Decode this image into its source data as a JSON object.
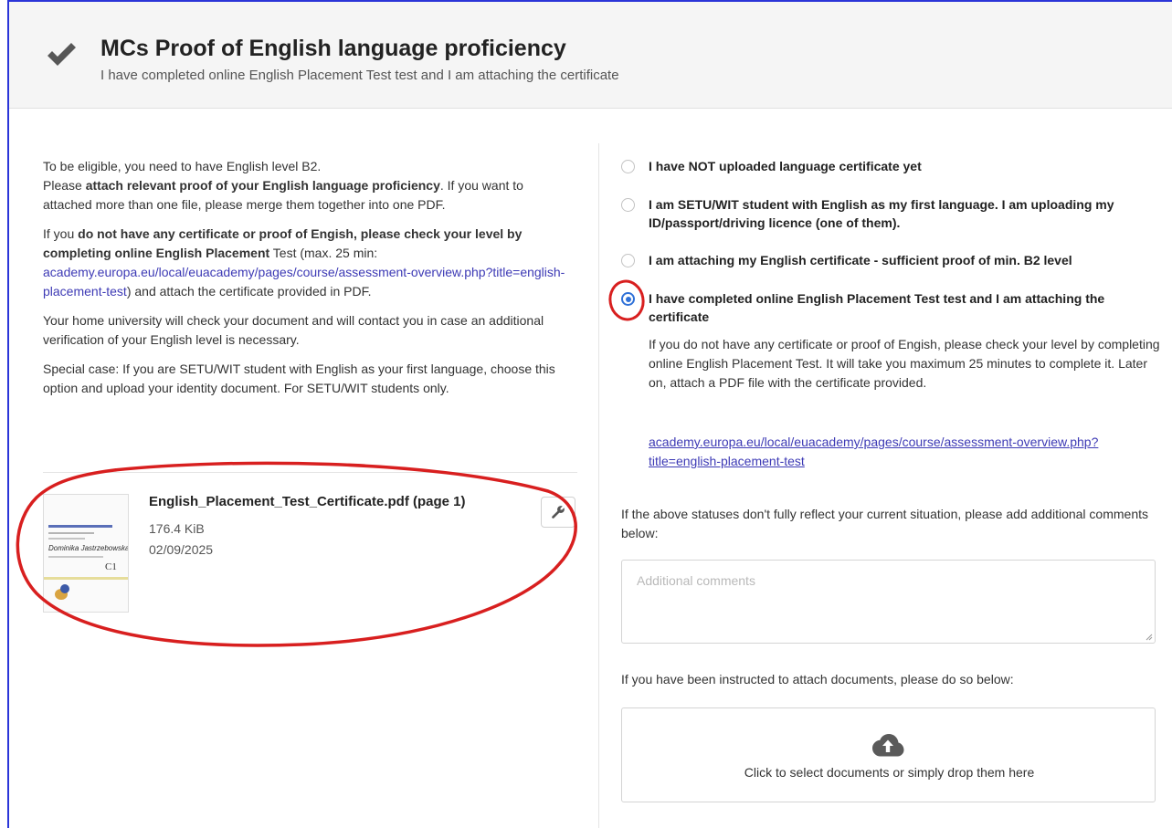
{
  "header": {
    "title": "MCs Proof of English language proficiency",
    "subtitle": "I have completed online English Placement Test test and I am attaching the certificate",
    "icon": "checkmark-icon"
  },
  "instructions": {
    "p1_line1": "To be eligible, you need to have English level B2.",
    "p1_line2_pre": "Please ",
    "p1_line2_bold": "attach relevant proof of your English language proficiency",
    "p1_line2_post": ". If you want to attached more than one file, please merge them together into one PDF.",
    "p2_pre": "If you ",
    "p2_bold": "do not have any certificate or proof of Engish, please check your level by completing online English Placement",
    "p2_mid": " Test (max. 25 min: ",
    "p2_link": "academy.europa.eu/local/euacademy/pages/course/assessment-overview.php?title=english-placement-test",
    "p2_post": ") and attach the certificate provided in PDF.",
    "p3": "Your home university will check your document and will contact you in case an additional verification of your English level is necessary.",
    "p4": "Special case: If you are SETU/WIT student with English as your first language, choose this option and upload your identity document. For SETU/WIT students only."
  },
  "attached_file": {
    "name": "English_Placement_Test_Certificate.pdf (page 1)",
    "size": "176.4 KiB",
    "date": "02/09/2025",
    "thumb_name": "Dominika Jastrzebowska",
    "thumb_grade": "C1",
    "action_icon": "wrench-icon"
  },
  "options": [
    {
      "label": "I have NOT uploaded language certificate yet",
      "selected": false
    },
    {
      "label": "I am SETU/WIT student with English as my first language. I am uploading my ID/passport/driving licence (one of them).",
      "selected": false
    },
    {
      "label": "I am attaching my English certificate - sufficient proof of min. B2 level",
      "selected": false
    },
    {
      "label": "I have completed online English Placement Test test and I am attaching the certificate",
      "selected": true
    }
  ],
  "selected_option": {
    "description": "If you do not have any certificate or proof of Engish, please check your level by completing online English Placement Test. It will take you maximum 25 minutes to complete it. Later on, attach a PDF file with the certificate provided.",
    "link": "academy.europa.eu/local/euacademy/pages/course/assessment-overview.php?title=english-placement-test"
  },
  "comments": {
    "label": "If the above statuses don't fully reflect your current situation, please add additional comments below:",
    "placeholder": "Additional comments",
    "value": ""
  },
  "attachments": {
    "label": "If you have been instructed to attach documents, please do so below:",
    "dropzone_text": "Click to select documents or simply drop them here",
    "icon": "cloud-upload-icon"
  },
  "colors": {
    "accent": "#2f71d8",
    "link": "#3d3ab5",
    "annotation": "#d81f1f",
    "frame": "#2b35d8"
  }
}
